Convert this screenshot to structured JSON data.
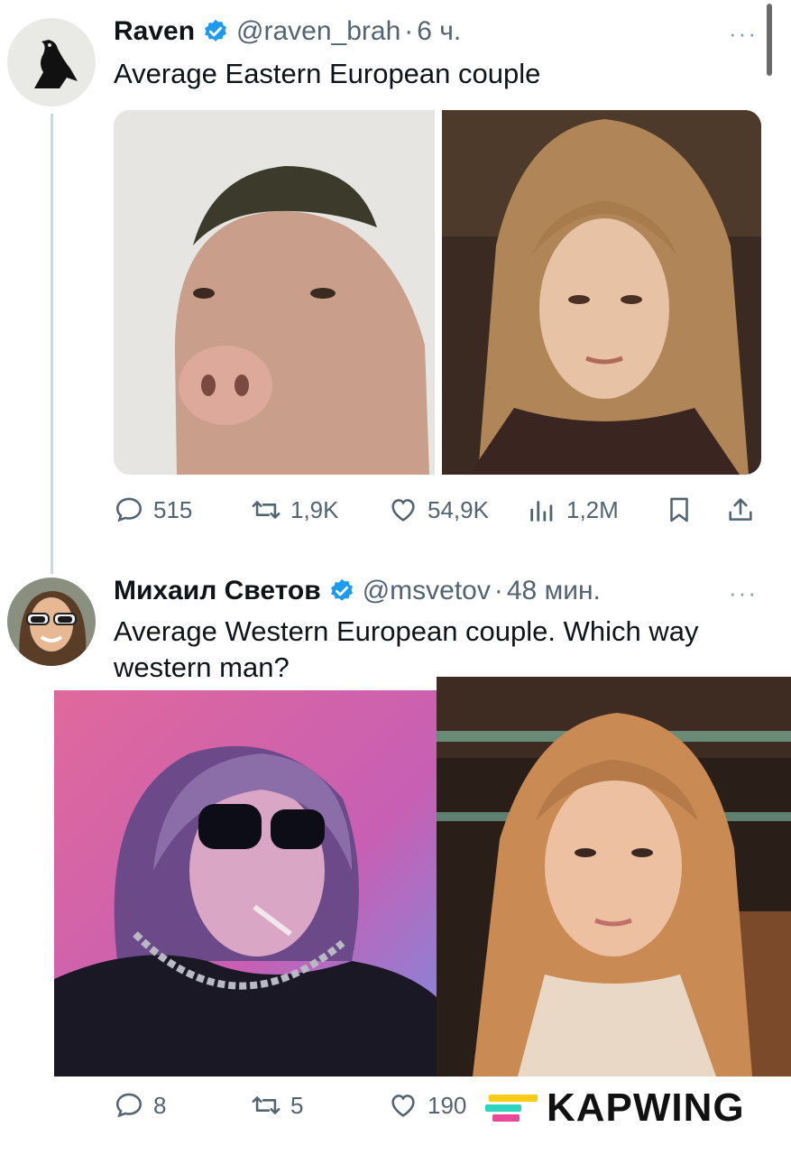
{
  "tweets": [
    {
      "name": "Raven",
      "handle": "@raven_brah",
      "separator": "·",
      "time": "6 ч.",
      "more": "···",
      "text": "Average Eastern European couple",
      "actions": {
        "reply": "515",
        "retweet": "1,9K",
        "like": "54,9K",
        "views": "1,2M"
      }
    },
    {
      "name": "Михаил Светов",
      "handle": "@msvetov",
      "separator": "·",
      "time": "48 мин.",
      "more": "···",
      "text": "Average Western European couple. Which way western man?",
      "actions": {
        "reply": "8",
        "retweet": "5",
        "like": "190"
      }
    }
  ],
  "watermark": {
    "text": "KAPWING",
    "colors": [
      "#2dd4bf",
      "#facc15",
      "#ec4899"
    ]
  },
  "colors": {
    "verified": "#1d9bf0",
    "muted": "#536471",
    "text": "#0f1419"
  },
  "icons": [
    "reply-icon",
    "retweet-icon",
    "like-icon",
    "views-icon",
    "bookmark-icon",
    "share-icon",
    "verified-badge-icon",
    "more-icon"
  ]
}
